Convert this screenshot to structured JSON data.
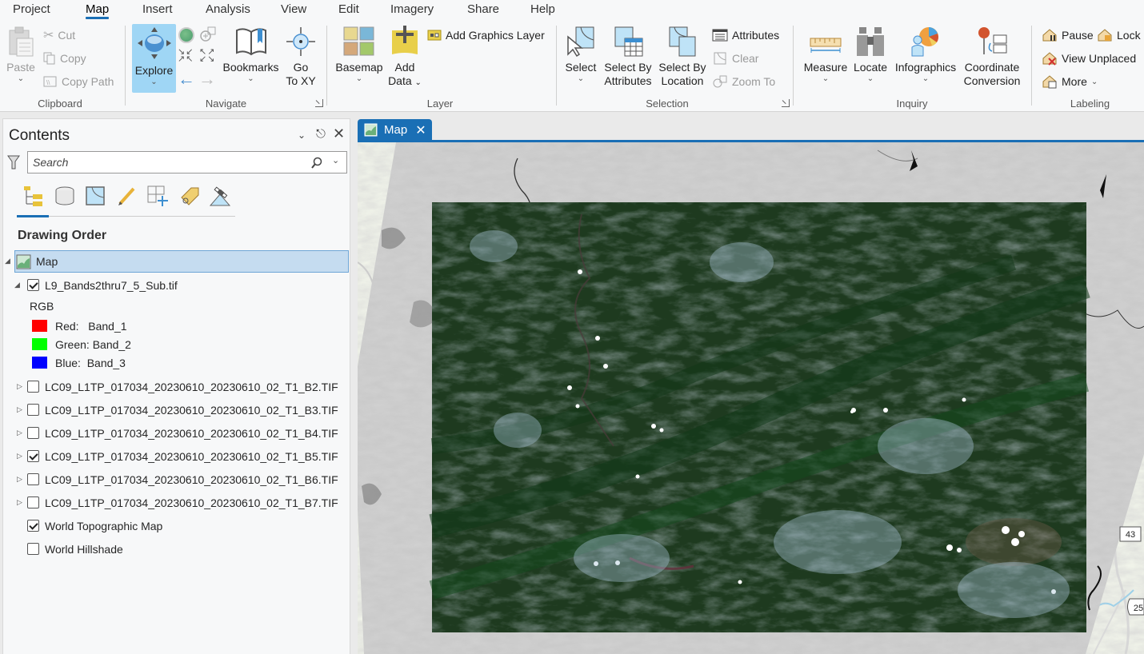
{
  "menu": {
    "tabs": [
      "Project",
      "Map",
      "Insert",
      "Analysis",
      "View",
      "Edit",
      "Imagery",
      "Share",
      "Help"
    ],
    "active_tab": "Map"
  },
  "ribbon": {
    "clipboard": {
      "label": "Clipboard",
      "paste": "Paste",
      "cut": "Cut",
      "copy": "Copy",
      "copy_path": "Copy Path"
    },
    "navigate": {
      "label": "Navigate",
      "explore": "Explore",
      "bookmarks": "Bookmarks",
      "go_to_xy_line1": "Go",
      "go_to_xy_line2": "To XY"
    },
    "layer": {
      "label": "Layer",
      "basemap": "Basemap",
      "add_data_line1": "Add",
      "add_data_line2": "Data",
      "add_graphics_layer": "Add Graphics Layer"
    },
    "selection": {
      "label": "Selection",
      "select": "Select",
      "select_by_attributes_line1": "Select By",
      "select_by_attributes_line2": "Attributes",
      "select_by_location_line1": "Select By",
      "select_by_location_line2": "Location",
      "attributes": "Attributes",
      "clear": "Clear",
      "zoom_to": "Zoom To"
    },
    "inquiry": {
      "label": "Inquiry",
      "measure": "Measure",
      "locate": "Locate",
      "infographics": "Infographics",
      "coordinate_conversion_line1": "Coordinate",
      "coordinate_conversion_line2": "Conversion"
    },
    "labeling": {
      "label": "Labeling",
      "pause": "Pause",
      "lock": "Lock",
      "view_unplaced": "View Unplaced",
      "more": "More"
    }
  },
  "contents": {
    "title": "Contents",
    "search_placeholder": "Search",
    "section_title": "Drawing Order",
    "map_node": "Map",
    "layers": [
      {
        "name": "L9_Bands2thru7_5_Sub.tif",
        "checked": true,
        "expanded": true
      },
      {
        "name": "LC09_L1TP_017034_20230610_20230610_02_T1_B2.TIF",
        "checked": false,
        "expanded": false
      },
      {
        "name": "LC09_L1TP_017034_20230610_20230610_02_T1_B3.TIF",
        "checked": false,
        "expanded": false
      },
      {
        "name": "LC09_L1TP_017034_20230610_20230610_02_T1_B4.TIF",
        "checked": false,
        "expanded": false
      },
      {
        "name": "LC09_L1TP_017034_20230610_20230610_02_T1_B5.TIF",
        "checked": true,
        "expanded": false
      },
      {
        "name": "LC09_L1TP_017034_20230610_20230610_02_T1_B6.TIF",
        "checked": false,
        "expanded": false
      },
      {
        "name": "LC09_L1TP_017034_20230610_20230610_02_T1_B7.TIF",
        "checked": false,
        "expanded": false
      },
      {
        "name": "World Topographic Map",
        "checked": true,
        "expanded": null
      },
      {
        "name": "World Hillshade",
        "checked": false,
        "expanded": null
      }
    ],
    "rgb": {
      "title": "RGB",
      "channels": [
        {
          "label": "Red:   Band_1",
          "color": "#ff0000"
        },
        {
          "label": "Green: Band_2",
          "color": "#00ff00"
        },
        {
          "label": "Blue:  Band_3",
          "color": "#0000ff"
        }
      ]
    }
  },
  "map_view": {
    "tab_label": "Map",
    "route_shields": [
      "43",
      "25"
    ],
    "accent_color": "#1a6fb5"
  }
}
